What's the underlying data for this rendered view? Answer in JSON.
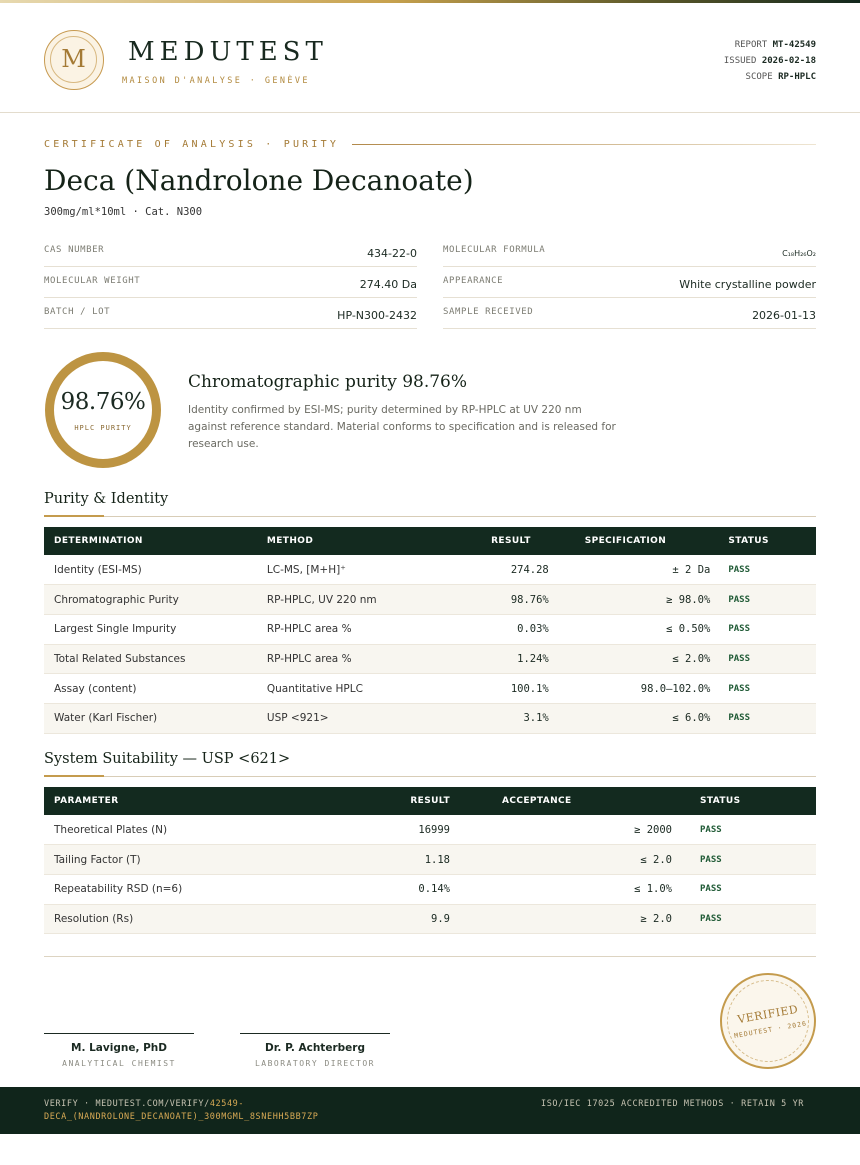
{
  "brand": {
    "logo_letter": "M",
    "name": "MEDUTEST",
    "tagline": "MAISON D'ANALYSE · GENÈVE"
  },
  "meta": {
    "report_label": "REPORT",
    "report_value": "MT-42549",
    "issued_label": "ISSUED",
    "issued_value": "2026-02-18",
    "scope_label": "SCOPE",
    "scope_value": "RP-HPLC"
  },
  "doc": {
    "eyebrow": "CERTIFICATE OF ANALYSIS · PURITY",
    "title": "Deca (Nandrolone Decanoate)",
    "subtitle": "300mg/ml*10ml  ·  Cat. N300"
  },
  "info": {
    "left": [
      {
        "label": "CAS NUMBER",
        "value": "434-22-0"
      },
      {
        "label": "MOLECULAR WEIGHT",
        "value": "274.40 Da"
      },
      {
        "label": "BATCH / LOT",
        "value": "HP-N300-2432"
      }
    ],
    "right": [
      {
        "label": "MOLECULAR FORMULA",
        "value": "C₁₈H₂₆O₂"
      },
      {
        "label": "APPEARANCE",
        "value": "White crystalline powder"
      },
      {
        "label": "SAMPLE RECEIVED",
        "value": "2026-01-13"
      }
    ]
  },
  "purity": {
    "value": "98.76%",
    "sub": "HPLC PURITY",
    "fraction": 0.9876,
    "heading": "Chromatographic purity 98.76%",
    "description": "Identity confirmed by ESI-MS; purity determined by RP-HPLC at UV 220 nm against reference standard. Material conforms to specification and is released for research use."
  },
  "table1": {
    "title": "Purity & Identity",
    "headers": [
      "DETERMINATION",
      "METHOD",
      "RESULT",
      "SPECIFICATION",
      "STATUS"
    ],
    "rows": [
      [
        "Identity (ESI-MS)",
        "LC-MS, [M+H]⁺",
        "274.28",
        "± 2 Da",
        "PASS"
      ],
      [
        "Chromatographic Purity",
        "RP-HPLC, UV 220 nm",
        "98.76%",
        "≥ 98.0%",
        "PASS"
      ],
      [
        "Largest Single Impurity",
        "RP-HPLC area %",
        "0.03%",
        "≤ 0.50%",
        "PASS"
      ],
      [
        "Total Related Substances",
        "RP-HPLC area %",
        "1.24%",
        "≤ 2.0%",
        "PASS"
      ],
      [
        "Assay (content)",
        "Quantitative HPLC",
        "100.1%",
        "98.0–102.0%",
        "PASS"
      ],
      [
        "Water (Karl Fischer)",
        "USP <921>",
        "3.1%",
        "≤ 6.0%",
        "PASS"
      ]
    ]
  },
  "table2": {
    "title": "System Suitability — USP <621>",
    "headers": [
      "PARAMETER",
      "RESULT",
      "ACCEPTANCE",
      "STATUS"
    ],
    "rows": [
      [
        "Theoretical Plates (N)",
        "16999",
        "≥ 2000",
        "PASS"
      ],
      [
        "Tailing Factor (T)",
        "1.18",
        "≤ 2.0",
        "PASS"
      ],
      [
        "Repeatability RSD (n=6)",
        "0.14%",
        "≤ 1.0%",
        "PASS"
      ],
      [
        "Resolution (Rs)",
        "9.9",
        "≥ 2.0",
        "PASS"
      ]
    ]
  },
  "signatures": [
    {
      "name": "M. Lavigne, PhD",
      "role": "ANALYTICAL CHEMIST"
    },
    {
      "name": "Dr. P. Achterberg",
      "role": "LABORATORY DIRECTOR"
    }
  ],
  "seal": {
    "top": "VERIFIED",
    "bottom": "MEDUTEST · 2026"
  },
  "footer": {
    "verify_prefix": "VERIFY · MEDUTEST.COM/VERIFY/",
    "verify_code": "42549-DECA_(NANDROLONE_DECANOATE)_300MGML_8SNEHH5BB7ZP",
    "right": "ISO/IEC 17025 ACCREDITED METHODS · RETAIN 5 YR"
  },
  "colors": {
    "accent_gold": "#bd9442",
    "dark_green": "#132a1f",
    "pass_green": "#1f5a35"
  }
}
